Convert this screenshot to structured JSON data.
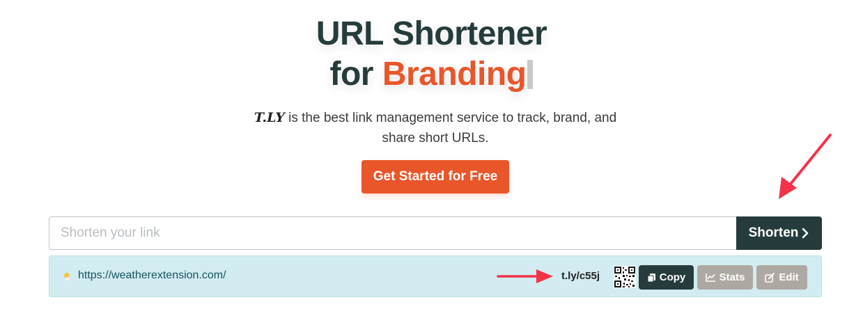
{
  "hero": {
    "title_line1": "URL Shortener",
    "title_line2_prefix": "for ",
    "title_line2_accent": "Branding",
    "brand_name": "T.LY",
    "subtitle_line1_rest": " is the best link management service to track, brand, and",
    "subtitle_line2": "share short URLs.",
    "cta_label": "Get Started for Free"
  },
  "shortener": {
    "placeholder": "Shorten your link",
    "value": "",
    "button_label": "Shorten"
  },
  "result": {
    "long_url": "https://weatherextension.com/",
    "short_url": "t.ly/c55j",
    "copy_label": "Copy",
    "stats_label": "Stats",
    "edit_label": "Edit"
  },
  "colors": {
    "accent": "#e8562a",
    "dark": "#263b3c",
    "result_bg": "#d2ecf1",
    "muted_button": "#aea8a3",
    "annotation_arrow": "#f2334a"
  }
}
